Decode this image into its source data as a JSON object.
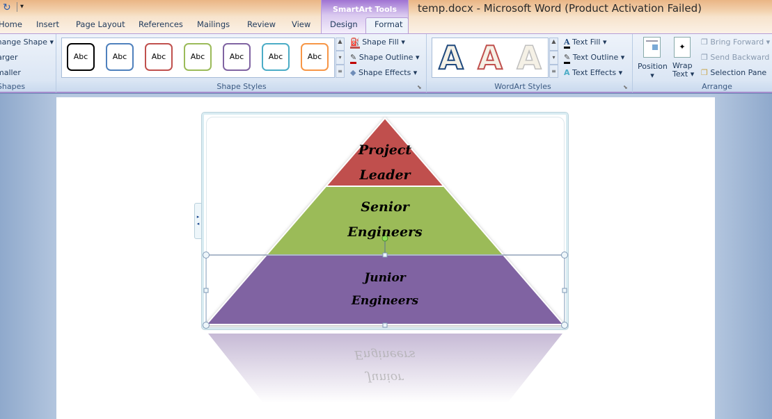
{
  "window": {
    "title": "temp.docx  -  Microsoft Word (Product Activation Failed)"
  },
  "quick_access": {
    "redo_icon": "redo-icon",
    "customize_icon": "dropdown-icon"
  },
  "contextual_tab_group": "SmartArt Tools",
  "tabs": [
    {
      "label": "Home"
    },
    {
      "label": "Insert"
    },
    {
      "label": "Page Layout"
    },
    {
      "label": "References"
    },
    {
      "label": "Mailings"
    },
    {
      "label": "Review"
    },
    {
      "label": "View"
    },
    {
      "label": "Design"
    },
    {
      "label": "Format",
      "active": true
    }
  ],
  "shapes_group": {
    "label": "Shapes",
    "items": [
      "Change Shape",
      "Larger",
      "Smaller"
    ]
  },
  "shape_styles": {
    "label": "Shape Styles",
    "swatches": [
      {
        "text": "Abc",
        "color": "#000000"
      },
      {
        "text": "Abc",
        "color": "#4f81bd"
      },
      {
        "text": "Abc",
        "color": "#c0504d"
      },
      {
        "text": "Abc",
        "color": "#9bbb59"
      },
      {
        "text": "Abc",
        "color": "#8064a2"
      },
      {
        "text": "Abc",
        "color": "#4bacc6"
      },
      {
        "text": "Abc",
        "color": "#f79646"
      }
    ],
    "commands": [
      "Shape Fill",
      "Shape Outline",
      "Shape Effects"
    ]
  },
  "wordart_styles": {
    "label": "WordArt Styles",
    "swatches": [
      {
        "text": "A",
        "color": "#1f497d"
      },
      {
        "text": "A",
        "color": "#c0504d"
      },
      {
        "text": "A",
        "color": "#bfbfbf"
      }
    ],
    "commands": [
      "Text Fill",
      "Text Outline",
      "Text Effects"
    ]
  },
  "arrange": {
    "label": "Arrange",
    "position": "Position",
    "wrap_text_1": "Wrap",
    "wrap_text_2": "Text",
    "bring_forward": "Bring Forward",
    "send_backward": "Send Backward",
    "selection_pane": "Selection Pane"
  },
  "smartart": {
    "levels": [
      {
        "line1": "Project",
        "line2": "Leader",
        "color": "#c0504d"
      },
      {
        "line1": "Senior",
        "line2": "Engineers",
        "color": "#9bbb59"
      },
      {
        "line1": "Junior",
        "line2": "Engineers",
        "color": "#8064a2"
      }
    ]
  }
}
